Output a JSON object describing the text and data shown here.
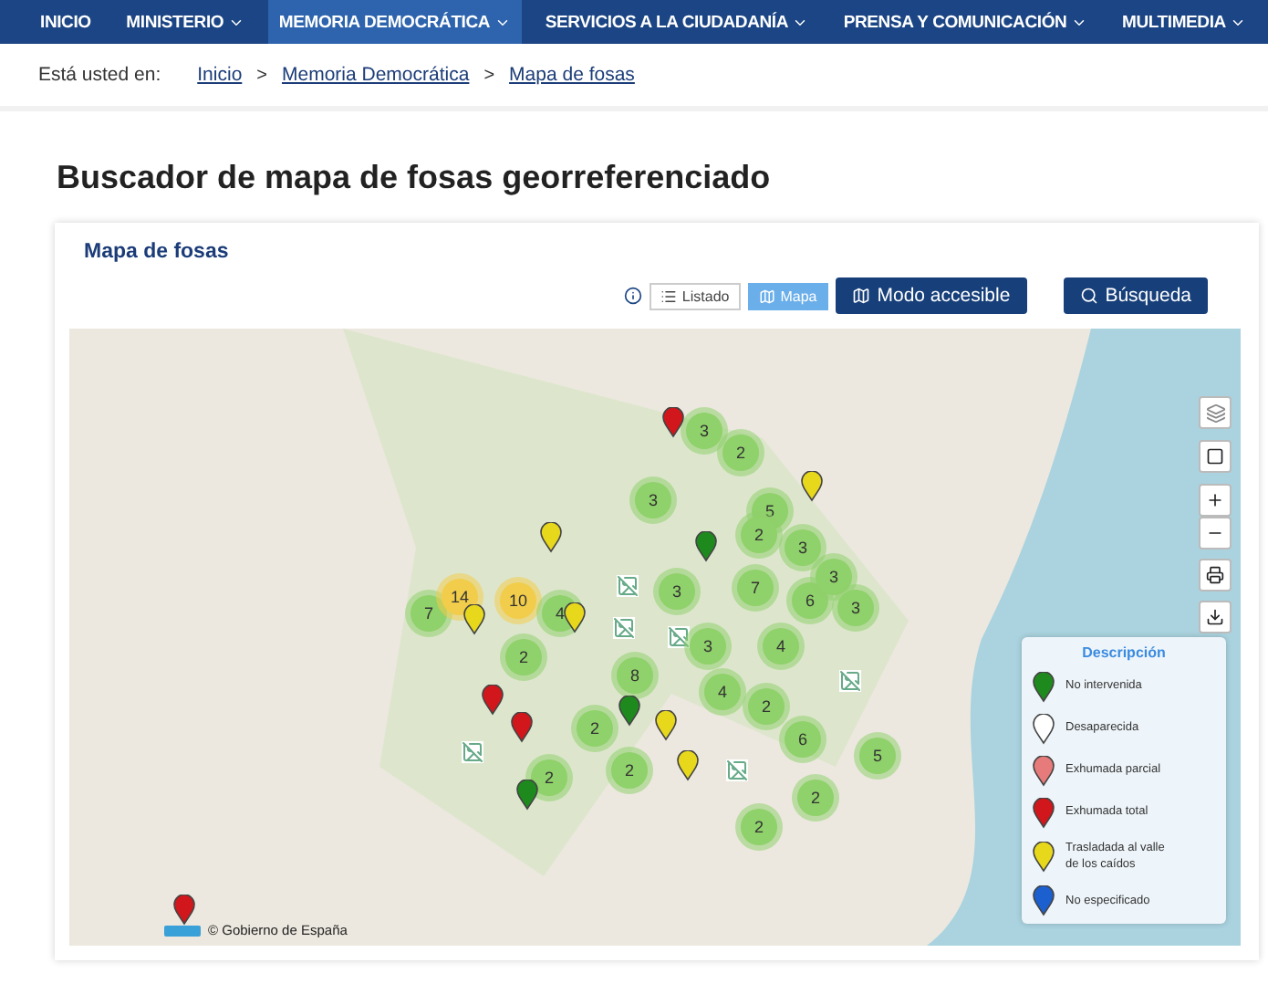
{
  "nav": [
    {
      "label": "INICIO",
      "dropdown": false,
      "selected": false
    },
    {
      "label": "MINISTERIO",
      "dropdown": true,
      "selected": false
    },
    {
      "label": "MEMORIA DEMOCRÁTICA",
      "dropdown": true,
      "selected": true
    },
    {
      "label": "SERVICIOS A LA CIUDADANÍA",
      "dropdown": true,
      "selected": false
    },
    {
      "label": "PRENSA Y COMUNICACIÓN",
      "dropdown": true,
      "selected": false
    },
    {
      "label": "MULTIMEDIA",
      "dropdown": true,
      "selected": false
    }
  ],
  "breadcrumb": {
    "prefix": "Está usted en:",
    "items": [
      "Inicio",
      "Memoria Democrática",
      "Mapa de fosas"
    ],
    "separator": ">"
  },
  "page_title": "Buscador de mapa de fosas georreferenciado",
  "card": {
    "title": "Mapa de fosas",
    "view_toggle": [
      {
        "label": "Listado",
        "kind": "list",
        "selected": false
      },
      {
        "label": "Mapa",
        "kind": "map",
        "selected": true
      }
    ],
    "buttons": [
      {
        "label": "Modo accesible",
        "kind": "accessible"
      },
      {
        "label": "Búsqueda",
        "kind": "search"
      }
    ],
    "map": {
      "clusters": [
        {
          "count": "3",
          "color": "#8fd16a"
        },
        {
          "count": "2",
          "color": "#8fd16a"
        },
        {
          "count": "3",
          "color": "#8fd16a"
        },
        {
          "count": "5",
          "color": "#8fd16a"
        },
        {
          "count": "2",
          "color": "#8fd16a"
        },
        {
          "count": "3",
          "color": "#8fd16a"
        },
        {
          "count": "7",
          "color": "#8fd16a"
        },
        {
          "count": "14",
          "color": "#f1cd4b"
        },
        {
          "count": "10",
          "color": "#f1cd4b"
        },
        {
          "count": "4",
          "color": "#8fd16a"
        },
        {
          "count": "3",
          "color": "#8fd16a"
        },
        {
          "count": "7",
          "color": "#8fd16a"
        },
        {
          "count": "6",
          "color": "#8fd16a"
        },
        {
          "count": "3",
          "color": "#8fd16a"
        },
        {
          "count": "3",
          "color": "#8fd16a"
        },
        {
          "count": "2",
          "color": "#8fd16a"
        },
        {
          "count": "3",
          "color": "#8fd16a"
        },
        {
          "count": "4",
          "color": "#8fd16a"
        },
        {
          "count": "8",
          "color": "#8fd16a"
        },
        {
          "count": "4",
          "color": "#8fd16a"
        },
        {
          "count": "2",
          "color": "#8fd16a"
        },
        {
          "count": "2",
          "color": "#8fd16a"
        },
        {
          "count": "6",
          "color": "#8fd16a"
        },
        {
          "count": "5",
          "color": "#8fd16a"
        },
        {
          "count": "2",
          "color": "#8fd16a"
        },
        {
          "count": "2",
          "color": "#8fd16a"
        },
        {
          "count": "2",
          "color": "#8fd16a"
        },
        {
          "count": "2",
          "color": "#8fd16a"
        }
      ],
      "pins": [
        {
          "color": "#d1171b"
        },
        {
          "color": "#e8d81c"
        },
        {
          "color": "#e8d81c"
        },
        {
          "color": "#1e8a1e"
        },
        {
          "color": "#e8d81c"
        },
        {
          "color": "#e8d81c"
        },
        {
          "color": "#d1171b"
        },
        {
          "color": "#d1171b"
        },
        {
          "color": "#1e8a1e"
        },
        {
          "color": "#e8d81c"
        },
        {
          "color": "#e8d81c"
        },
        {
          "color": "#1e8a1e"
        },
        {
          "color": "#d1171b"
        }
      ],
      "attribution": "© Gobierno de España",
      "legend": {
        "title": "Descripción",
        "items": [
          {
            "label": "No intervenida",
            "color": "#1e8a1e"
          },
          {
            "label": "Desaparecida",
            "color": "#ffffff"
          },
          {
            "label": "Exhumada parcial",
            "color": "#e77a7a"
          },
          {
            "label": "Exhumada total",
            "color": "#d1171b"
          },
          {
            "label": "Trasladada al valle de los caídos",
            "color": "#e8d81c"
          },
          {
            "label": "No especificado",
            "color": "#1c5fcf"
          }
        ]
      }
    }
  }
}
